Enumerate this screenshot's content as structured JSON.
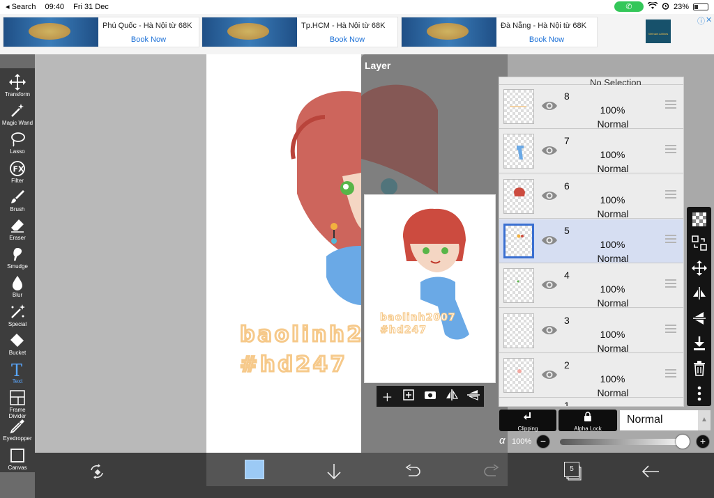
{
  "status_bar": {
    "back_label": "◂ Search",
    "time": "09:40",
    "date": "Fri 31 Dec",
    "battery": "23%"
  },
  "ads": [
    {
      "title": "Phú Quốc - Hà Nội từ 68K",
      "cta": "Book Now"
    },
    {
      "title": "Tp.HCM - Hà Nội từ 68K",
      "cta": "Book Now"
    },
    {
      "title": "Đà Nẵng - Hà Nội từ 68K",
      "cta": "Book Now"
    }
  ],
  "ad_logo_text": "Vietnam Airlines",
  "tools": [
    {
      "label": "Transform"
    },
    {
      "label": "Magic Wand"
    },
    {
      "label": "Lasso"
    },
    {
      "label": "Filter"
    },
    {
      "label": "Brush"
    },
    {
      "label": "Eraser"
    },
    {
      "label": "Smudge"
    },
    {
      "label": "Blur"
    },
    {
      "label": "Special"
    },
    {
      "label": "Bucket"
    },
    {
      "label": "Text"
    },
    {
      "label": "Frame Divider"
    },
    {
      "label": "Eyedropper"
    },
    {
      "label": "Canvas"
    }
  ],
  "canvas_text": {
    "line1": "baolinh2",
    "line2": "#hd247"
  },
  "preview_text": {
    "line1": "baolinh2007",
    "line2": "#hd247"
  },
  "layer_panel": {
    "title": "Layer",
    "top_partial": "No Selection",
    "layers": [
      {
        "number": "8",
        "opacity": "100%",
        "mode": "Normal",
        "selected": false
      },
      {
        "number": "7",
        "opacity": "100%",
        "mode": "Normal",
        "selected": false
      },
      {
        "number": "6",
        "opacity": "100%",
        "mode": "Normal",
        "selected": false
      },
      {
        "number": "5",
        "opacity": "100%",
        "mode": "Normal",
        "selected": true
      },
      {
        "number": "4",
        "opacity": "100%",
        "mode": "Normal",
        "selected": false
      },
      {
        "number": "3",
        "opacity": "100%",
        "mode": "Normal",
        "selected": false
      },
      {
        "number": "2",
        "opacity": "100%",
        "mode": "Normal",
        "selected": false
      }
    ],
    "bottom_partial": "1"
  },
  "layer_options": {
    "clipping_label": "Clipping",
    "alpha_lock_label": "Alpha Lock",
    "blend_mode": "Normal",
    "alpha_symbol": "α",
    "alpha_value": "100%",
    "alpha_level": 1.0
  },
  "bottom_bar": {
    "primary_color": "#9ccaf5",
    "layer_count": "5"
  }
}
